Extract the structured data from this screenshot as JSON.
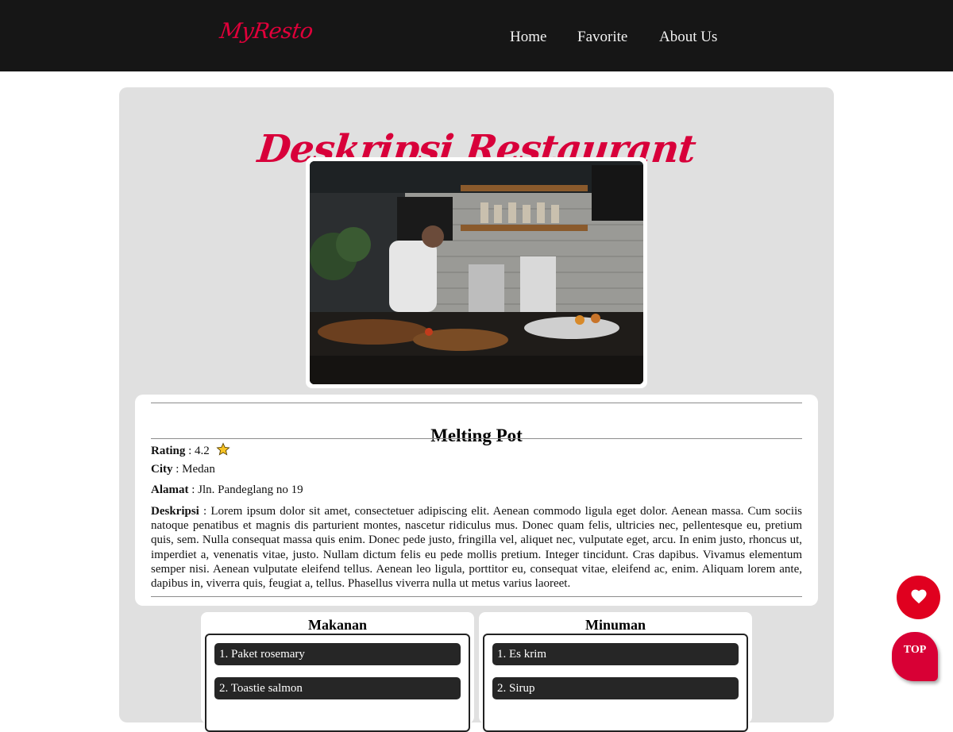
{
  "brand": {
    "logo": "MyResto",
    "accent_color": "#e0003a"
  },
  "nav": {
    "home": "Home",
    "favorite": "Favorite",
    "about": "About Us"
  },
  "page": {
    "title": "Deskripsi Restaurant"
  },
  "restaurant": {
    "name": "Melting Pot",
    "rating_label": "Rating",
    "rating_value": ": 4.2",
    "city_label": "City",
    "city_value": ": Medan",
    "address_label": "Alamat",
    "address_value": ": Jln. Pandeglang no 19",
    "description_label": "Deskripsi",
    "description_value": ": Lorem ipsum dolor sit amet, consectetuer adipiscing elit. Aenean commodo ligula eget dolor. Aenean massa. Cum sociis natoque penatibus et magnis dis parturient montes, nascetur ridiculus mus. Donec quam felis, ultricies nec, pellentesque eu, pretium quis, sem. Nulla consequat massa quis enim. Donec pede justo, fringilla vel, aliquet nec, vulputate eget, arcu. In enim justo, rhoncus ut, imperdiet a, venenatis vitae, justo. Nullam dictum felis eu pede mollis pretium. Integer tincidunt. Cras dapibus. Vivamus elementum semper nisi. Aenean vulputate eleifend tellus. Aenean leo ligula, porttitor eu, consequat vitae, eleifend ac, enim. Aliquam lorem ante, dapibus in, viverra quis, feugiat a, tellus. Phasellus viverra nulla ut metus varius laoreet.",
    "image_icon": "restaurant-kitchen-photo"
  },
  "menus": {
    "food": {
      "title": "Makanan",
      "items": [
        "1. Paket rosemary",
        "2. Toastie salmon"
      ]
    },
    "drink": {
      "title": "Minuman",
      "items": [
        "1. Es krim",
        "2. Sirup"
      ]
    }
  },
  "floating": {
    "favorite_icon": "heart-icon",
    "top_label": "TOP"
  }
}
